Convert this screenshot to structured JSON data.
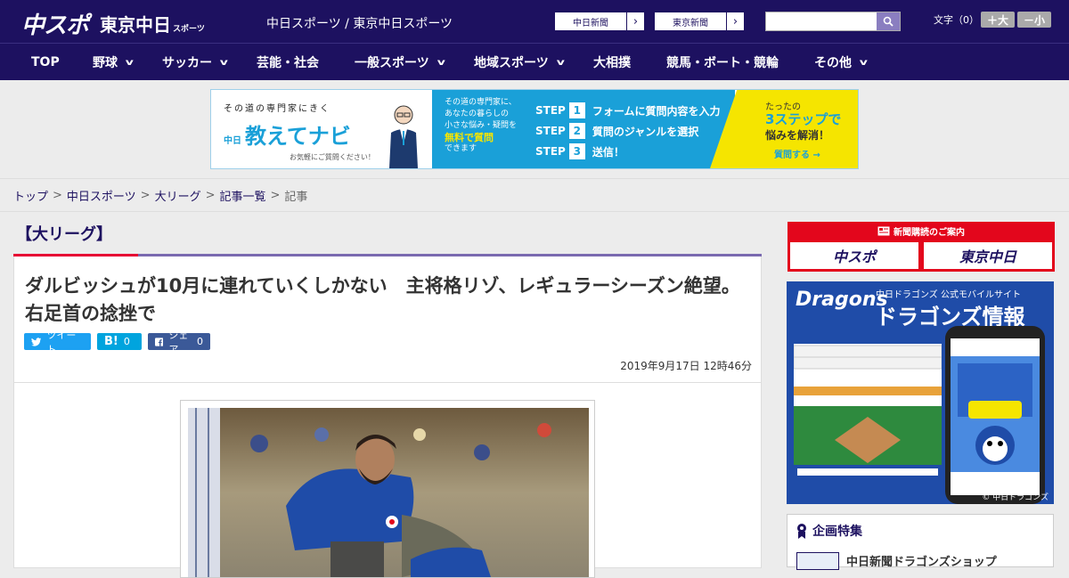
{
  "header": {
    "logo_chuspo": "中スポ",
    "logo_tokyo": "東京中日",
    "logo_tokyo_small": "スポーツ",
    "site_name": "中日スポーツ / 東京中日スポーツ",
    "paper_buttons": [
      {
        "label": "中日新聞"
      },
      {
        "label": "東京新聞"
      }
    ],
    "search": {
      "placeholder": ""
    },
    "fontsize_label": "文字（0）",
    "font_plus": "＋大",
    "font_minus": "－小"
  },
  "nav": {
    "items": [
      {
        "label": "TOP"
      },
      {
        "label": "野球"
      },
      {
        "label": "サッカー"
      },
      {
        "label": "芸能・社会"
      },
      {
        "label": "一般スポーツ"
      },
      {
        "label": "地域スポーツ"
      },
      {
        "label": "大相撲"
      },
      {
        "label": "競馬・ボート・競輪"
      },
      {
        "label": "その他"
      }
    ]
  },
  "banner_ad": {
    "tagline": "その道の専門家にきく",
    "brand": "教えてナビ",
    "brand_prefix": "中日",
    "note": "お気軽にご質問ください！",
    "mid_line1": "その道の専門家に、",
    "mid_line2": "あなたの暮らしの",
    "mid_line3": "小さな悩み・疑問を",
    "mid_highlight": "無料で質問",
    "mid_line4": "できます",
    "steps": [
      {
        "num": "1",
        "label": "フォームに質問内容を入力"
      },
      {
        "num": "2",
        "label": "質問のジャンルを選択"
      },
      {
        "num": "3",
        "label": "送信！"
      }
    ],
    "step_word": "STEP",
    "right_t1": "たったの",
    "right_t2": "3ステップで",
    "right_t3": "悩みを解消！",
    "right_cta": "質問する →"
  },
  "breadcrumb": {
    "items": [
      "トップ",
      "中日スポーツ",
      "大リーグ",
      "記事一覧"
    ],
    "current": "記事",
    "sep": ">"
  },
  "article": {
    "category": "【大リーグ】",
    "headline": "ダルビッシュが10月に連れていくしかない　主将格リゾ、レギュラーシーズン絶望。右足首の捻挫で",
    "share": {
      "tweet": "ツイート",
      "hatena_label": "B!",
      "hatena_count": "0",
      "fb_label": "シェア",
      "fb_count": "0"
    },
    "date": "2019年9月17日 12時46分"
  },
  "sidebar": {
    "subscribe_title": "新聞購読のご案内",
    "sub_btn1": "中スポ",
    "sub_btn2": "東京中日",
    "dragons_logo": "Dragons",
    "dragons_sub": "中日ドラゴンズ 公式モバイルサイト",
    "dragons_title": "ドラゴンズ情報",
    "dragons_copy": "© 中日ドラゴンズ",
    "kikaku_title": "企画特集",
    "kikaku_item": "中日新聞ドラゴンズショップ"
  },
  "colors": {
    "brand_navy": "#1d1160",
    "accent_red": "#e60033",
    "twitter": "#1da1f2",
    "hatena": "#00a4de",
    "facebook": "#3b5998"
  }
}
